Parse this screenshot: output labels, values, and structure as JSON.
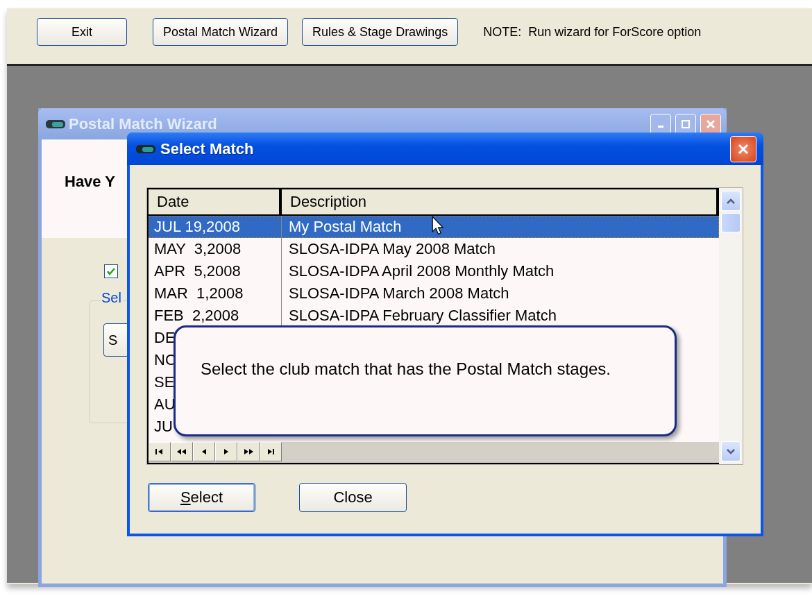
{
  "toolbar": {
    "buttons": [
      "Exit",
      "Postal Match Wizard",
      "Rules & Stage Drawings"
    ],
    "note": "NOTE:  Run wizard for ForScore option"
  },
  "wizard": {
    "title": "Postal Match Wizard",
    "heading": "Have Y",
    "checkbox": {
      "checked": true
    },
    "group_label": "Sel",
    "button": "S"
  },
  "dialog": {
    "title": "Select Match",
    "columns": [
      "Date",
      "Description"
    ],
    "rows": [
      {
        "date": "JUL 19,2008",
        "description": "My Postal Match",
        "selected": true
      },
      {
        "date": "MAY  3,2008",
        "description": "SLOSA-IDPA May 2008 Match",
        "selected": false
      },
      {
        "date": "APR  5,2008",
        "description": "SLOSA-IDPA April 2008 Monthly Match",
        "selected": false
      },
      {
        "date": "MAR  1,2008",
        "description": "SLOSA-IDPA March 2008 Match",
        "selected": false
      },
      {
        "date": "FEB  2,2008",
        "description": "SLOSA-IDPA February Classifier Match",
        "selected": false
      },
      {
        "date": "DE",
        "selected": false
      },
      {
        "date": "NO",
        "selected": false
      },
      {
        "date": "SE",
        "selected": false
      },
      {
        "date": "AU",
        "selected": false
      },
      {
        "date": "JU",
        "selected": false
      }
    ],
    "buttons": [
      {
        "label": "Select",
        "mnemonic": true
      },
      {
        "label": "Close",
        "mnemonic": false
      }
    ]
  },
  "callout": {
    "text": "Select the club match that has the Postal Match stages."
  }
}
